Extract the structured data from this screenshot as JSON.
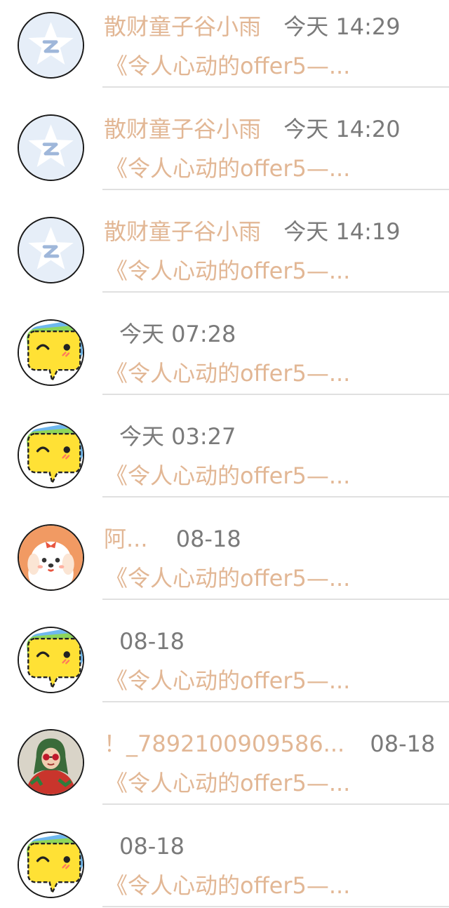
{
  "messages": [
    {
      "avatar": "qzone-star-avatar",
      "name": "散财童子谷小雨",
      "time": "今天 14:29",
      "preview": "《令人心动的offer5—..."
    },
    {
      "avatar": "qzone-star-avatar",
      "name": "散财童子谷小雨",
      "time": "今天 14:20",
      "preview": "《令人心动的offer5—..."
    },
    {
      "avatar": "qzone-star-avatar",
      "name": "散财童子谷小雨",
      "time": "今天 14:19",
      "preview": "《令人心动的offer5—..."
    },
    {
      "avatar": "yellow-chat-bubble-avatar",
      "name": "",
      "time": "今天 07:28",
      "preview": "《令人心动的offer5—..."
    },
    {
      "avatar": "yellow-chat-bubble-avatar",
      "name": "",
      "time": "今天 03:27",
      "preview": "《令人心动的offer5—..."
    },
    {
      "avatar": "cartoon-dog-avatar",
      "name": "阿...",
      "time": "08-18",
      "preview": "《令人心动的offer5—..."
    },
    {
      "avatar": "yellow-chat-bubble-avatar",
      "name": "",
      "time": "08-18",
      "preview": "《令人心动的offer5—..."
    },
    {
      "avatar": "person-photo-avatar",
      "name": "！_7892100909586...",
      "time": "08-18",
      "preview": "《令人心动的offer5—..."
    },
    {
      "avatar": "yellow-chat-bubble-avatar",
      "name": "",
      "time": "08-18",
      "preview": "《令人心动的offer5—..."
    }
  ],
  "colors": {
    "name": "#e2b795",
    "preview": "#e2b795",
    "time": "#7a7a7a",
    "divider": "#e0e0e0",
    "avatar_border": "#1a1a1a"
  }
}
